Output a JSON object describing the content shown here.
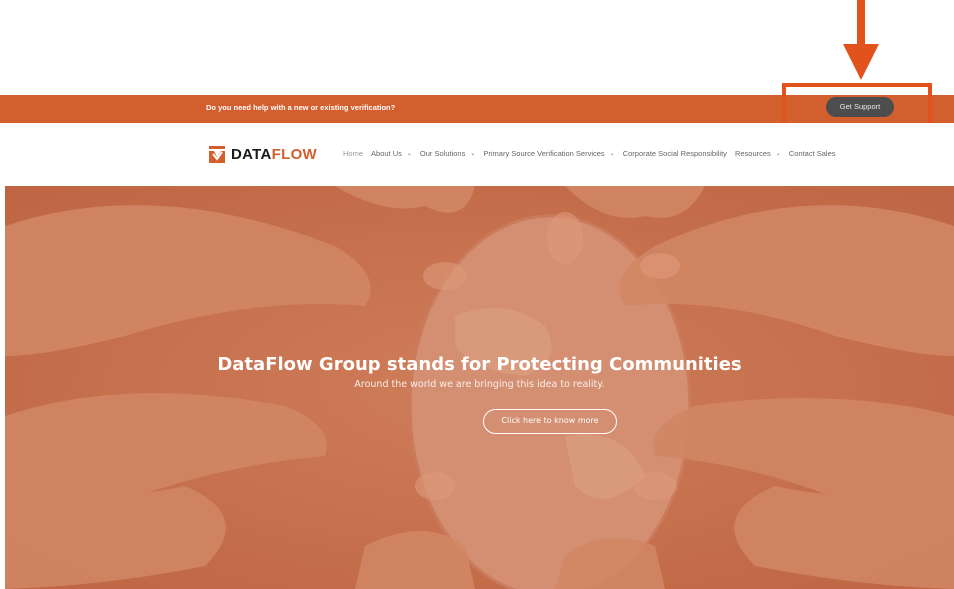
{
  "topbar": {
    "help_text": "Do you need help with a new or existing verification?",
    "support_button": "Get Support"
  },
  "logo": {
    "word_data": "DATA",
    "word_flow": "FLOW",
    "icon": "check-shield-icon"
  },
  "nav": {
    "items": [
      {
        "label": "Home",
        "dropdown": false
      },
      {
        "label": "About Us",
        "dropdown": true
      },
      {
        "label": "Our Solutions",
        "dropdown": true
      },
      {
        "label": "Primary Source Verification Services",
        "dropdown": true
      },
      {
        "label": "Corporate Social Responsibility",
        "dropdown": false
      },
      {
        "label": "Resources",
        "dropdown": true
      },
      {
        "label": "Contact Sales",
        "dropdown": false
      }
    ],
    "chevron_icon": "chevron-down-icon"
  },
  "hero": {
    "title": "DataFlow Group stands for Protecting Communities",
    "subtitle": "Around the world we are bringing this idea to reality.",
    "cta": "Click here to know more"
  },
  "colors": {
    "brand_orange": "#d35f2f",
    "annotation_red": "#e2521d",
    "support_button_bg": "#4d4d4d",
    "hero_overlay": "#c6704d"
  }
}
